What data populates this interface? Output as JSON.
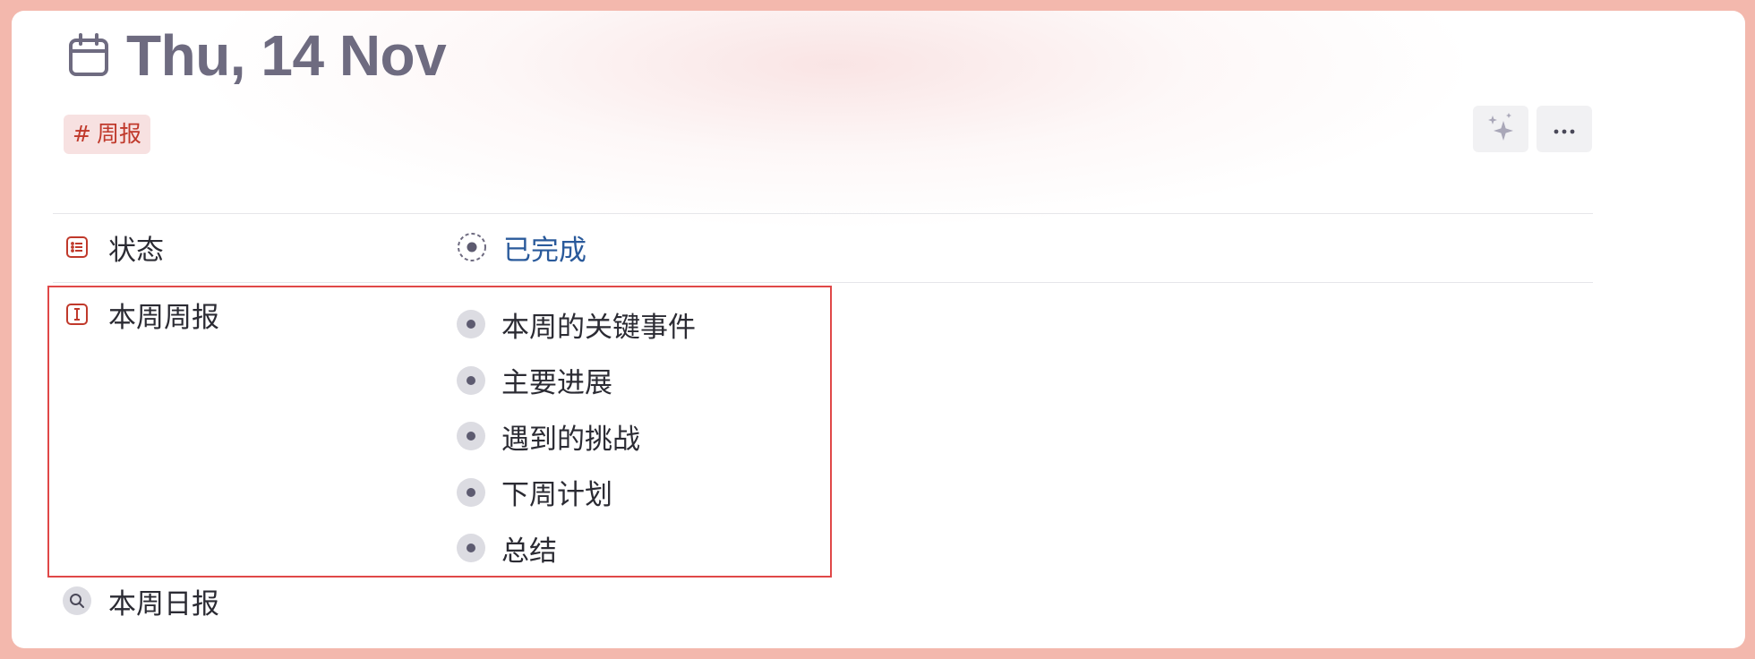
{
  "header": {
    "title": "Thu, 14 Nov",
    "tag": {
      "hash": "#",
      "label": "周报"
    }
  },
  "properties": [
    {
      "label": "状态",
      "value": "已完成"
    },
    {
      "label": "本周周报",
      "items": [
        "本周的关键事件",
        "主要进展",
        "遇到的挑战",
        "下周计划",
        "总结"
      ]
    },
    {
      "label": "本周日报"
    }
  ],
  "icons": {
    "title": "calendar-icon",
    "ai": "sparkles-icon",
    "more": "more-horizontal-icon",
    "status": "list-icon",
    "weekly": "text-cursor-icon",
    "daily": "search-icon"
  },
  "colors": {
    "accent_red": "#c0392b",
    "status_blue": "#2a5a9b",
    "title_gray": "#6e6b80",
    "highlight": "#e04848",
    "background_frame": "#f3b8ad"
  }
}
